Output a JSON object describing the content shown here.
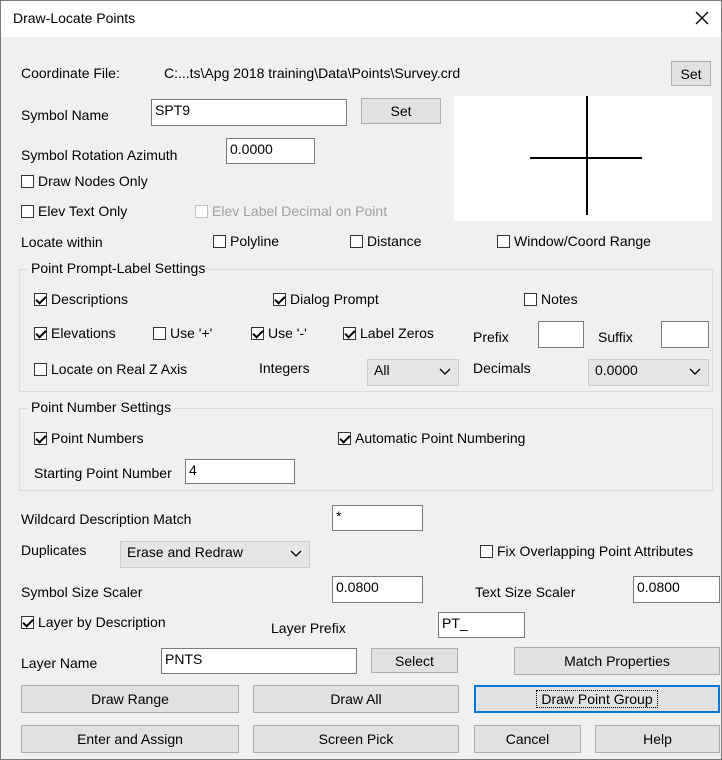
{
  "window": {
    "title": "Draw-Locate Points"
  },
  "icons": {
    "close": "close-icon",
    "chevron": "chevron-down-icon"
  },
  "coordinate_file": {
    "label": "Coordinate File:",
    "path": "C:...ts\\Apg 2018 training\\Data\\Points\\Survey.crd",
    "set_label": "Set"
  },
  "symbol": {
    "name_label": "Symbol Name",
    "name_value": "SPT9",
    "set_label": "Set",
    "rotation_label": "Symbol Rotation Azimuth",
    "rotation_value": "0.0000"
  },
  "options": {
    "draw_nodes_only": "Draw Nodes Only",
    "elev_text_only": "Elev Text Only",
    "elev_label_decimal": "Elev Label Decimal on Point"
  },
  "locate": {
    "label": "Locate within",
    "polyline": "Polyline",
    "distance": "Distance",
    "window_range": "Window/Coord Range"
  },
  "prompt_settings": {
    "title": "Point Prompt-Label Settings",
    "descriptions": "Descriptions",
    "dialog_prompt": "Dialog Prompt",
    "notes": "Notes",
    "elevations": "Elevations",
    "use_plus": "Use '+'",
    "use_minus": "Use '-'",
    "label_zeros": "Label Zeros",
    "prefix": "Prefix",
    "suffix": "Suffix",
    "locate_real_z": "Locate on Real Z Axis",
    "integers": "Integers",
    "integers_value": "All",
    "decimals": "Decimals",
    "decimals_value": "0.0000"
  },
  "number_settings": {
    "title": "Point Number Settings",
    "point_numbers": "Point Numbers",
    "auto_numbering": "Automatic Point Numbering",
    "starting_label": "Starting Point Number",
    "starting_value": "4"
  },
  "wildcard": {
    "label": "Wildcard Description Match",
    "value": "*"
  },
  "duplicates": {
    "label": "Duplicates",
    "value": "Erase and Redraw",
    "fix_overlap": "Fix Overlapping Point Attributes"
  },
  "scalers": {
    "symbol_label": "Symbol Size Scaler",
    "symbol_value": "0.0800",
    "text_label": "Text Size Scaler",
    "text_value": "0.0800"
  },
  "layer": {
    "by_description": "Layer by Description",
    "prefix_label": "Layer Prefix",
    "prefix_value": "PT_",
    "name_label": "Layer Name",
    "name_value": "PNTS",
    "select": "Select",
    "match_properties": "Match Properties"
  },
  "buttons": {
    "draw_range": "Draw Range",
    "draw_all": "Draw All",
    "draw_point_group": "Draw Point Group",
    "enter_assign": "Enter and Assign",
    "screen_pick": "Screen Pick",
    "cancel": "Cancel",
    "help": "Help"
  }
}
